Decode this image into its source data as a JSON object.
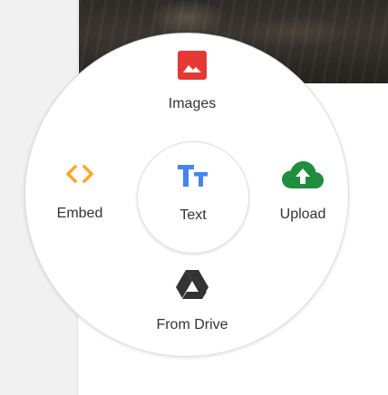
{
  "menu": {
    "items": {
      "images": {
        "label": "Images",
        "icon": "image-icon",
        "color": "#e53935"
      },
      "embed": {
        "label": "Embed",
        "icon": "code-icon",
        "color": "#f9a825"
      },
      "text": {
        "label": "Text",
        "icon": "text-format-icon",
        "color": "#4285f4"
      },
      "upload": {
        "label": "Upload",
        "icon": "cloud-upload-icon",
        "color": "#1e8e3e"
      },
      "drive": {
        "label": "From Drive",
        "icon": "google-drive-icon",
        "color": "#333333"
      }
    }
  }
}
